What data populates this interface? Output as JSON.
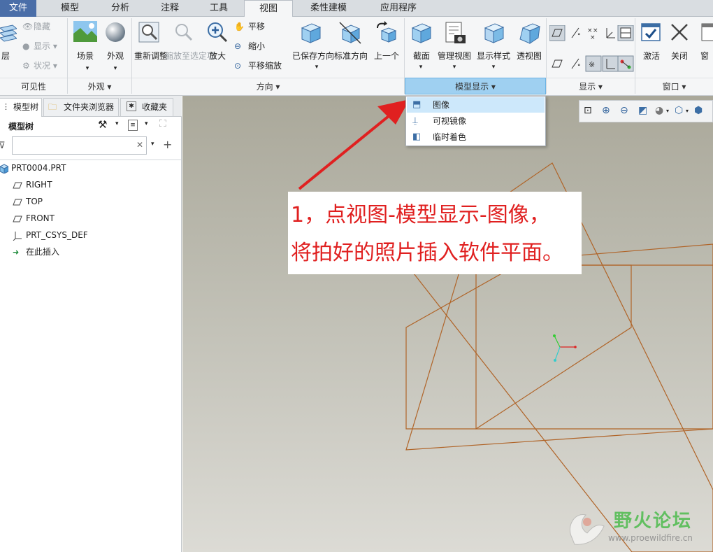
{
  "menu": {
    "tabs": [
      "文件",
      "模型",
      "分析",
      "注释",
      "工具",
      "视图",
      "柔性建模",
      "应用程序"
    ]
  },
  "ribbon": {
    "visibility": {
      "layer_label": "层",
      "hide_label": "隐藏",
      "show_label": "显示",
      "status_label": "状况",
      "footer": "可见性"
    },
    "appearance": {
      "scene_label": "场景",
      "appearance_label": "外观",
      "footer": "外观"
    },
    "orientation": {
      "refit_label": "重新调整",
      "zoom_selected_label": "缩放至选定项",
      "zoom_in_label": "放大",
      "pan_label": "平移",
      "zoom_out_label": "缩小",
      "pan_zoom_label": "平移缩放",
      "saved_orient_label": "已保存方向",
      "standard_orient_label": "标准方向",
      "previous_label": "上一个",
      "footer": "方向"
    },
    "model_display": {
      "section_label": "截面",
      "manage_views_label": "管理视图",
      "display_style_label": "显示样式",
      "perspective_label": "透视图",
      "footer": "模型显示"
    },
    "show": {
      "footer": "显示"
    },
    "window": {
      "activate_label": "激活",
      "close_label": "关闭",
      "window_label": "窗",
      "footer": "窗口"
    }
  },
  "left_panel": {
    "tabs": {
      "model_tree": "模型树",
      "folder_browser": "文件夹浏览器",
      "favorites": "收藏夹"
    },
    "header_title": "模型树",
    "search": {
      "value": "",
      "placeholder": ""
    },
    "tree": [
      {
        "label": "PRT0004.PRT",
        "icon": "part-icon"
      },
      {
        "label": "RIGHT",
        "icon": "datum-plane-icon"
      },
      {
        "label": "TOP",
        "icon": "datum-plane-icon"
      },
      {
        "label": "FRONT",
        "icon": "datum-plane-icon"
      },
      {
        "label": "PRT_CSYS_DEF",
        "icon": "csys-icon"
      },
      {
        "label": "在此插入",
        "icon": "insert-arrow-icon"
      }
    ]
  },
  "dropdown": {
    "items": [
      {
        "label": "图像",
        "icon": "image-icon",
        "highlighted": true
      },
      {
        "label": "可视镜像",
        "icon": "mirror-icon",
        "highlighted": false
      },
      {
        "label": "临时着色",
        "icon": "shade-icon",
        "highlighted": false
      }
    ]
  },
  "annotation": {
    "line1": "1，点视图-模型显示-图像，",
    "line2": "将拍好的照片插入软件平面。"
  },
  "watermark": {
    "title": "野火论坛",
    "url": "www.proewildfire.cn"
  },
  "colors": {
    "file_tab": "#4a6ea8",
    "highlight": "#9fd0f1",
    "datum_plane": "#b06428",
    "annotation_red": "#e02020",
    "watermark_green": "#4dbb4d"
  }
}
